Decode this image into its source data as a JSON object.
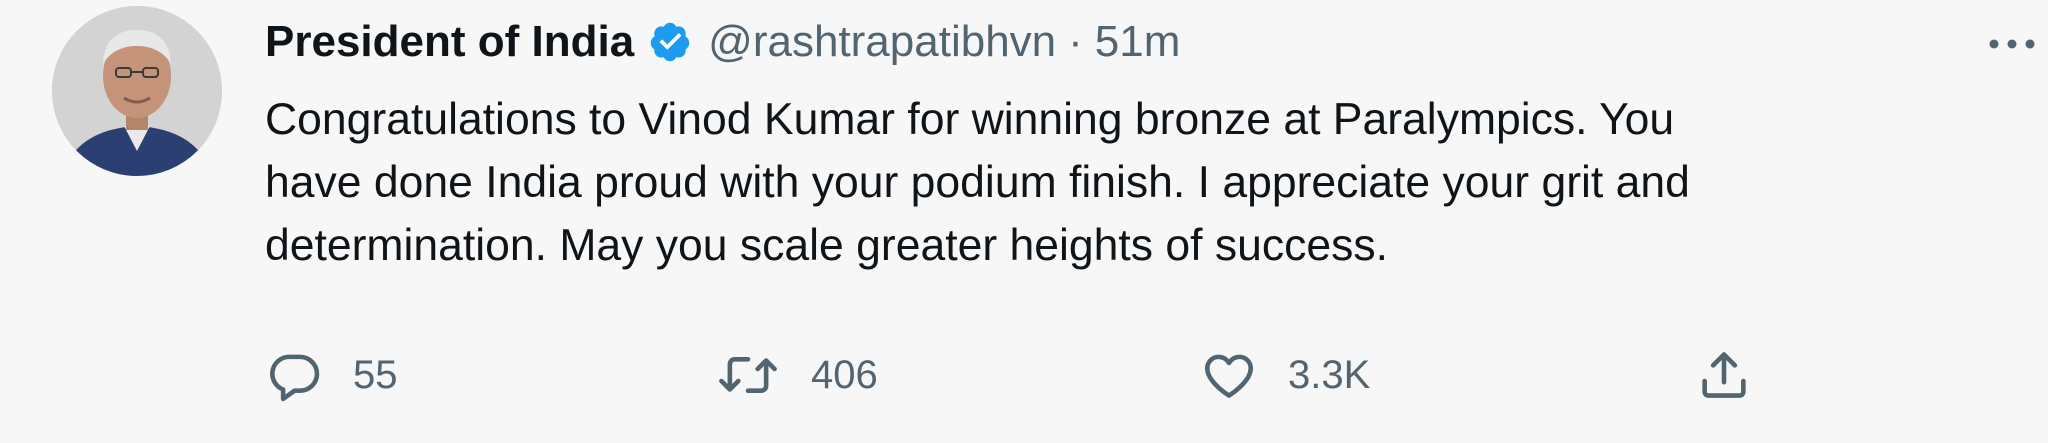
{
  "tweet": {
    "author": {
      "display_name": "President of India",
      "verified": true,
      "handle": "@rashtrapatibhvn",
      "separator": "·",
      "timestamp": "51m",
      "avatar_icon": "profile-photo"
    },
    "text": "Congratulations to Vinod Kumar for winning bronze at Paralympics. You\nhave done India proud with your podium finish. I appreciate your grit and\ndetermination. May you scale greater heights of success.",
    "actions": {
      "reply": {
        "icon": "reply-icon",
        "count": "55"
      },
      "retweet": {
        "icon": "retweet-icon",
        "count": "406"
      },
      "like": {
        "icon": "heart-icon",
        "count": "3.3K"
      },
      "share": {
        "icon": "share-icon"
      }
    },
    "more_icon": "more-options-icon"
  },
  "colors": {
    "background": "#f7f7f7",
    "primary_text": "#0f1419",
    "secondary_text": "#536471",
    "verified_badge": "#1d9bf0"
  }
}
